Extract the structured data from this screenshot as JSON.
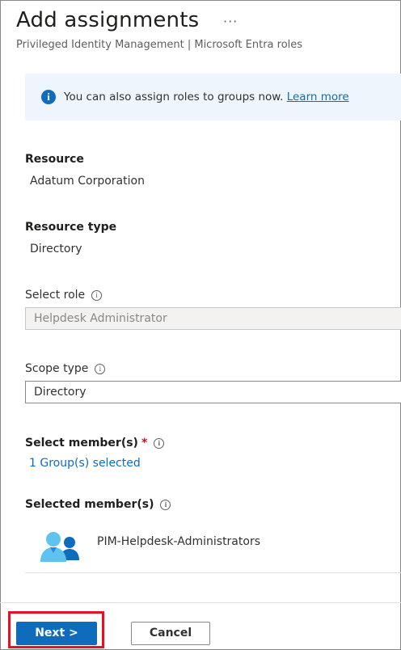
{
  "header": {
    "title": "Add assignments",
    "more_label": "···",
    "subtitle": "Privileged Identity Management | Microsoft Entra roles"
  },
  "info_banner": {
    "icon": "info-icon",
    "text": "You can also assign roles to groups now.",
    "link": "Learn more"
  },
  "resource": {
    "label": "Resource",
    "value": "Adatum Corporation"
  },
  "resource_type": {
    "label": "Resource type",
    "value": "Directory"
  },
  "select_role": {
    "label": "Select role",
    "value": "Helpdesk Administrator",
    "disabled": true
  },
  "scope_type": {
    "label": "Scope type",
    "value": "Directory"
  },
  "select_members": {
    "label": "Select member(s)",
    "required_mark": "*",
    "link": "1 Group(s) selected"
  },
  "selected_members": {
    "label": "Selected member(s)",
    "items": [
      {
        "name": "PIM-Helpdesk-Administrators",
        "icon": "group-icon"
      }
    ]
  },
  "footer": {
    "next_label": "Next >",
    "cancel_label": "Cancel"
  },
  "colors": {
    "primary": "#0f6cbd",
    "highlight": "#e81123",
    "banner_bg": "#eef5fc",
    "required": "#c50f1f"
  }
}
